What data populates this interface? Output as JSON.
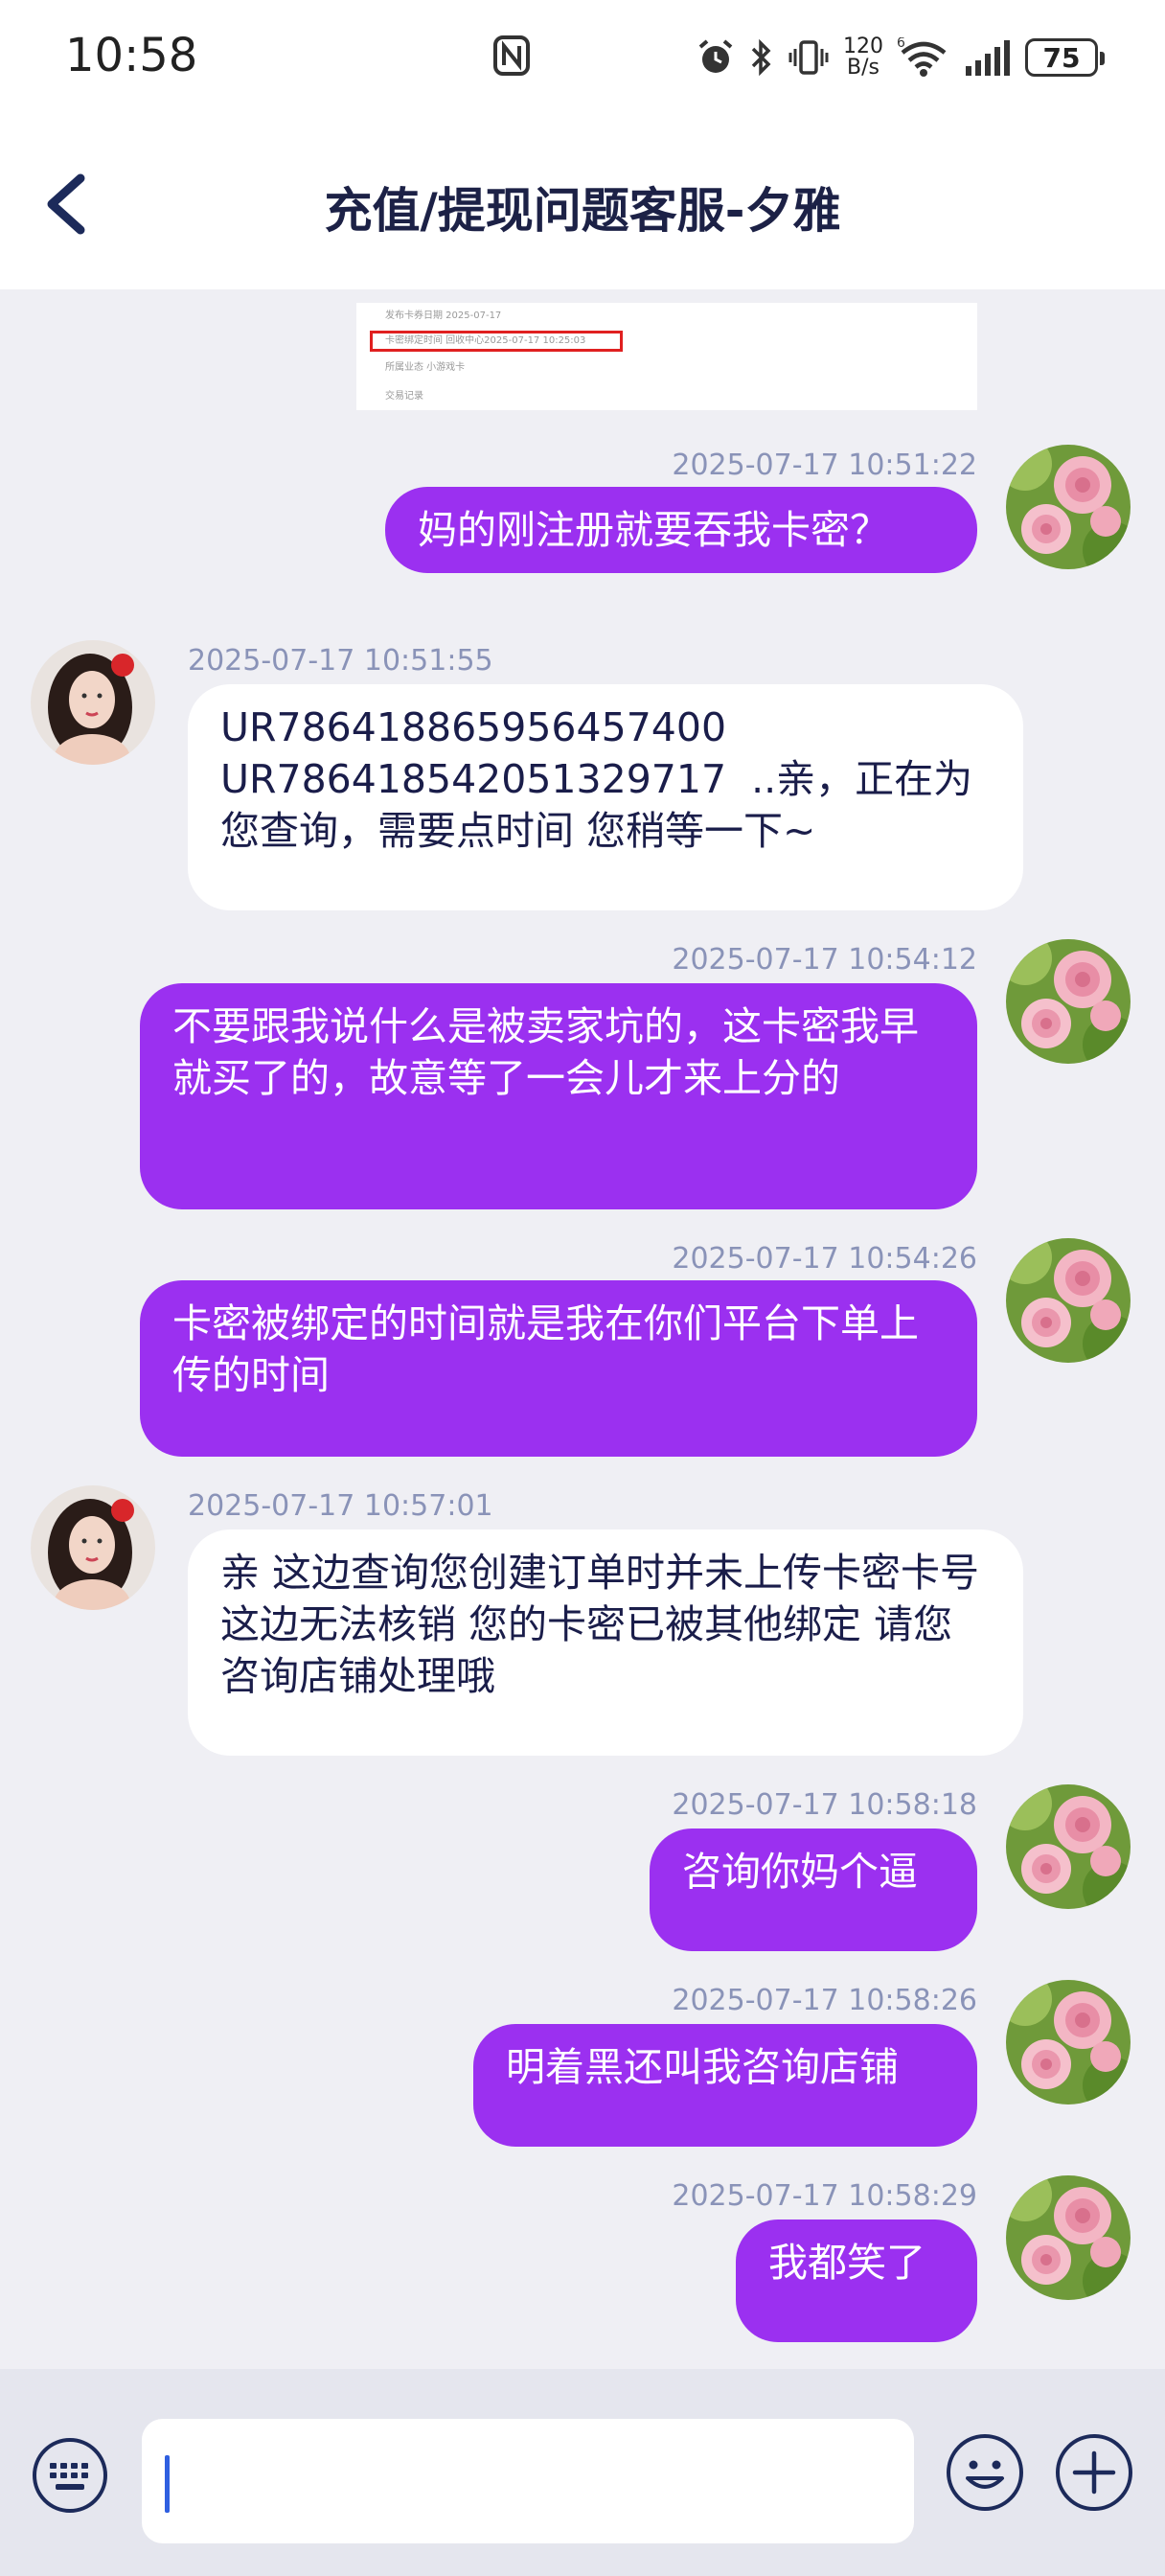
{
  "status": {
    "time": "10:58",
    "net_speed_top": "120",
    "net_speed_bottom": "B/s",
    "signal_label": "6",
    "battery": "75"
  },
  "header": {
    "title": "充值/提现问题客服-夕雅"
  },
  "screenshot_card": {
    "rows": [
      "发布卡券日期   2025-07-17",
      "卡密绑定时间   回收中心2025-07-17 10:25:03",
      "所属业态   小游戏卡",
      "交易记录"
    ]
  },
  "messages": [
    {
      "side": "out",
      "time": "2025-07-17 10:51:22",
      "text": "妈的刚注册就要吞我卡密？"
    },
    {
      "side": "in",
      "time": "2025-07-17 10:51:55",
      "text": "UR786418865956457400\nUR786418542051329717  ..亲，正在为您查询，需要点时间 您稍等一下~"
    },
    {
      "side": "out",
      "time": "2025-07-17 10:54:12",
      "text": "不要跟我说什么是被卖家坑的，这卡密我早就买了的，故意等了一会儿才来上分的"
    },
    {
      "side": "out",
      "time": "2025-07-17 10:54:26",
      "text": "卡密被绑定的时间就是我在你们平台下单上传的时间"
    },
    {
      "side": "in",
      "time": "2025-07-17 10:57:01",
      "text": "亲 这边查询您创建订单时并未上传卡密卡号 这边无法核销 您的卡密已被其他绑定 请您咨询店铺处理哦"
    },
    {
      "side": "out",
      "time": "2025-07-17 10:58:18",
      "text": "咨询你妈个逼"
    },
    {
      "side": "out",
      "time": "2025-07-17 10:58:26",
      "text": "明着黑还叫我咨询店铺"
    },
    {
      "side": "out",
      "time": "2025-07-17 10:58:29",
      "text": "我都笑了"
    }
  ],
  "input": {
    "placeholder": ""
  },
  "colors": {
    "outgoing_bubble": "#9b30f0",
    "incoming_bubble": "#ffffff",
    "background": "#efeff4",
    "timestamp": "#8a93b8"
  },
  "icons": [
    "back-icon",
    "keyboard-icon",
    "emoji-icon",
    "plus-icon",
    "rose-avatar",
    "agent-avatar"
  ]
}
